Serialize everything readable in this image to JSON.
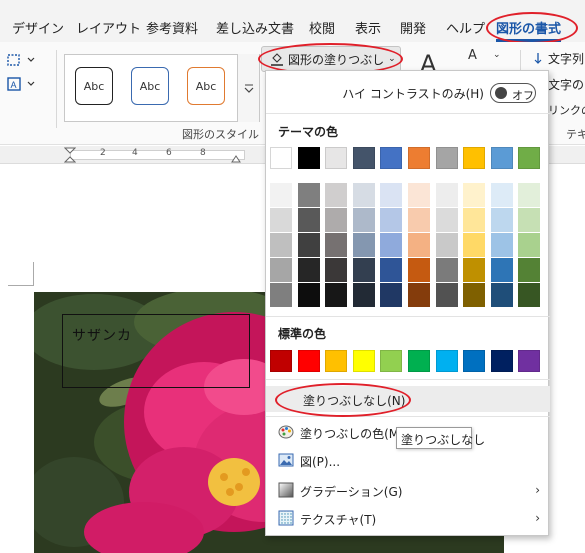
{
  "tabs": [
    "デザイン",
    "レイアウト",
    "参考資料",
    "差し込み文書",
    "校閲",
    "表示",
    "開発",
    "ヘルプ",
    "図形の書式"
  ],
  "ribbon": {
    "shape_style_samples": [
      "Abc",
      "Abc",
      "Abc"
    ],
    "shape_style_group_label": "図形のスタイル",
    "fill_button_label": "図形の塗りつぶし",
    "font_glyph": "A",
    "right_items": [
      "文字列",
      "文字の",
      "リンクの"
    ],
    "right_group_label": "テキ"
  },
  "ruler": {
    "ticks": [
      "2",
      "4",
      "6",
      "8"
    ]
  },
  "document": {
    "textbox_text": "サザンカ"
  },
  "menu": {
    "high_contrast_label": "ハイ コントラストのみ(H)",
    "toggle_text": "オフ",
    "theme_colors_heading": "テーマの色",
    "standard_colors_heading": "標準の色",
    "no_fill_label": "塗りつぶしなし(N)",
    "items": [
      {
        "label": "塗りつぶしの色(M)...",
        "icon": "palette-icon",
        "submenu": false
      },
      {
        "label": "図(P)...",
        "icon": "picture-icon",
        "submenu": false
      },
      {
        "label": "グラデーション(G)",
        "icon": "gradient-icon",
        "submenu": true
      },
      {
        "label": "テクスチャ(T)",
        "icon": "texture-icon",
        "submenu": true
      }
    ],
    "theme_colors": [
      [
        "#ffffff",
        "#000000",
        "#e7e6e6",
        "#44546a",
        "#4472c4",
        "#ed7d31",
        "#a5a5a5",
        "#ffc000",
        "#5b9bd5",
        "#70ad47"
      ],
      [
        "#f2f2f2",
        "#7f7f7f",
        "#d0cece",
        "#d6dce4",
        "#dae3f3",
        "#fbe5d6",
        "#ededed",
        "#fff2cc",
        "#ddebf7",
        "#e2efda"
      ],
      [
        "#d9d9d9",
        "#595959",
        "#aeabab",
        "#adb9ca",
        "#b4c7e7",
        "#f8cbad",
        "#dbdbdb",
        "#ffe699",
        "#bdd7ee",
        "#c6e0b4"
      ],
      [
        "#bfbfbf",
        "#404040",
        "#767171",
        "#8497b0",
        "#8faadc",
        "#f4b183",
        "#c9c9c9",
        "#ffd966",
        "#9dc3e6",
        "#a9d18e"
      ],
      [
        "#a6a6a6",
        "#262626",
        "#3b3838",
        "#333f50",
        "#2f5597",
        "#c55a11",
        "#7b7b7b",
        "#bf9000",
        "#2e75b6",
        "#548235"
      ],
      [
        "#7f7f7f",
        "#0d0d0d",
        "#171717",
        "#222a35",
        "#203864",
        "#843c0c",
        "#525252",
        "#7f6000",
        "#1f4e79",
        "#375623"
      ]
    ],
    "standard_colors": [
      "#c00000",
      "#ff0000",
      "#ffc000",
      "#ffff00",
      "#92d050",
      "#00b050",
      "#00b0f0",
      "#0070c0",
      "#002060",
      "#7030a0"
    ]
  },
  "tooltip": "塗りつぶしなし",
  "colors": {
    "accent": "#1a56a8",
    "highlight_circle": "#e0202a"
  }
}
